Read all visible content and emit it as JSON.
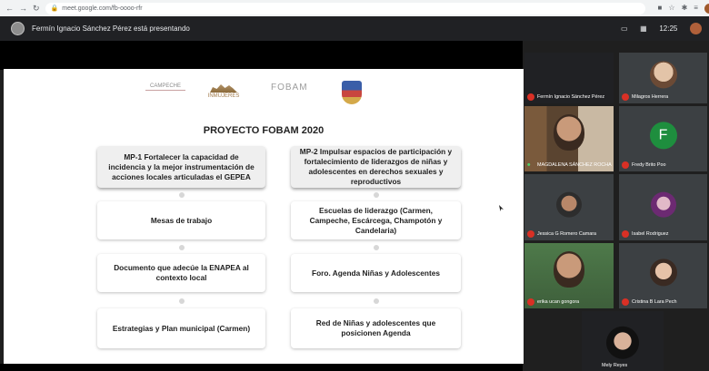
{
  "browser": {
    "url": "meet.google.com/fb-oooo-rfr",
    "time": "12:25"
  },
  "meet": {
    "presenting_text": "Fermín Ignacio Sánchez Pérez está presentando"
  },
  "slide": {
    "logos": [
      {
        "name": "logo-campeche",
        "text": "CAMPECHE"
      },
      {
        "name": "logo-inmujeres",
        "text": "INMUJERES"
      },
      {
        "name": "logo-fobam",
        "text": "FOBAM"
      },
      {
        "name": "logo-shield",
        "text": ""
      }
    ],
    "title": "PROYECTO FOBAM 2020",
    "col1": [
      "MP-1 Fortalecer la capacidad de incidencia y la mejor instrumentación de acciones locales articuladas el GEPEA",
      "Mesas de trabajo",
      "Documento que adecúe la ENAPEA al contexto local",
      "Estrategias y Plan municipal (Carmen)"
    ],
    "col2": [
      "MP-2 Impulsar espacios de participación y fortalecimiento de liderazgos de niñas y adolescentes en derechos sexuales y reproductivos",
      "Escuelas de liderazgo (Carmen, Campeche, Escárcega, Champotón y Candelaria)",
      "Foro. Agenda Niñas y Adolescentes",
      "Red de Niñas y adolescentes que posicionen Agenda"
    ]
  },
  "participants": [
    {
      "name": "Fermín Ignacio Sánchez Pérez",
      "muted": true
    },
    {
      "name": "Milagros Herrera",
      "muted": true
    },
    {
      "name": "MAGDALENA SÁNCHEZ ROCHA",
      "muted": false
    },
    {
      "name": "Fredy Brito Poo",
      "muted": true,
      "initial": "F"
    },
    {
      "name": "Jessica G Romero Camara",
      "muted": true
    },
    {
      "name": "Isabel Rodriguez",
      "muted": true
    },
    {
      "name": "erika ucan gongora",
      "muted": true
    },
    {
      "name": "Cristina B Lara Pech",
      "muted": true
    },
    {
      "name": "Mely Reyes",
      "muted": false
    }
  ]
}
